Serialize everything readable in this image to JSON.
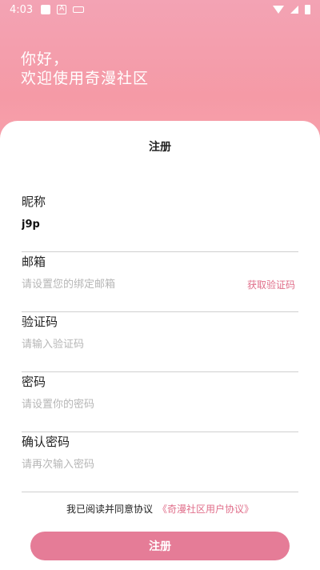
{
  "status_bar": {
    "time": "4:03",
    "icons": [
      "square-icon",
      "a-icon",
      "keyboard-icon",
      "wifi-icon",
      "signal-icon",
      "battery-icon"
    ]
  },
  "hero": {
    "greeting_line1": "你好，",
    "greeting_line2": "欢迎使用奇漫社区",
    "background_color": "#f59aa6"
  },
  "card": {
    "title": "注册",
    "fields": {
      "nickname": {
        "label": "昵称",
        "value": "j9p",
        "placeholder": ""
      },
      "email": {
        "label": "邮箱",
        "value": "",
        "placeholder": "请设置您的绑定邮箱",
        "action": "获取验证码"
      },
      "code": {
        "label": "验证码",
        "value": "",
        "placeholder": "请输入验证码"
      },
      "password": {
        "label": "密码",
        "value": "",
        "placeholder": "请设置你的密码"
      },
      "confirm": {
        "label": "确认密码",
        "value": "",
        "placeholder": "请再次输入密码"
      }
    },
    "agreement_text": "我已阅读并同意协议",
    "agreement_link": "《奇漫社区用户协议》",
    "submit_label": "注册",
    "accent_color": "#e57c97"
  }
}
